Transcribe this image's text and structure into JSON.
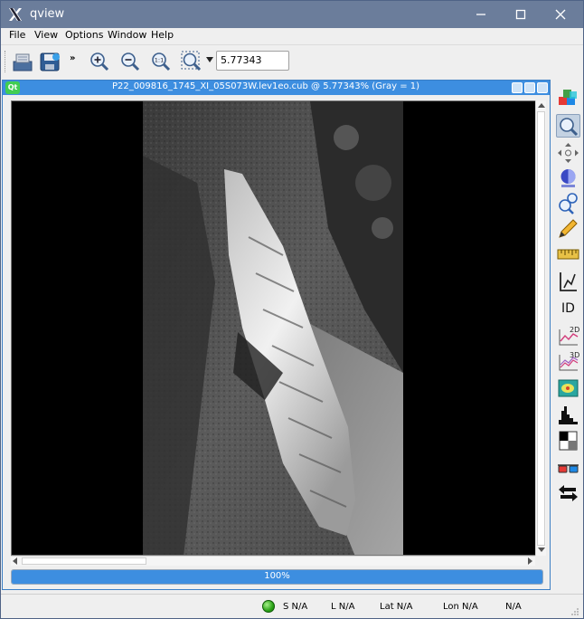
{
  "window": {
    "title": "qview"
  },
  "menu": [
    {
      "label": "File"
    },
    {
      "label": "View"
    },
    {
      "label": "Options"
    },
    {
      "label": "Window"
    },
    {
      "label": "Help"
    }
  ],
  "toolbar": {
    "more_glyph": "»",
    "zoom_value": "5.77343"
  },
  "subwindow": {
    "title": "P22_009816_1745_XI_05S073W.lev1eo.cub @ 5.77343% (Gray = 1)",
    "logo_text": "Qt"
  },
  "progress": {
    "percent": 100,
    "label": "100%"
  },
  "right_tools": [
    {
      "icon": "blend-cubes-icon"
    },
    {
      "icon": "zoom-tool-icon",
      "active": true
    },
    {
      "icon": "pan-tool-icon"
    },
    {
      "icon": "stretch-tool-icon"
    },
    {
      "icon": "find-tool-icon"
    },
    {
      "icon": "edit-tool-icon"
    },
    {
      "icon": "measure-tool-icon"
    },
    {
      "icon": "spectral-plot-icon"
    },
    {
      "icon": "id-tool-icon",
      "label": "ID"
    },
    {
      "icon": "plot-2d-icon",
      "label": "2D"
    },
    {
      "icon": "plot-3d-icon",
      "label": "3D"
    },
    {
      "icon": "map-stretch-icon"
    },
    {
      "icon": "histogram-icon"
    },
    {
      "icon": "contrast-icon"
    },
    {
      "icon": "stereo-glasses-icon"
    },
    {
      "icon": "link-arrows-icon"
    }
  ],
  "status": {
    "s": "S N/A",
    "l": "L N/A",
    "lat": "Lat N/A",
    "lon": "Lon N/A",
    "dn": "N/A"
  },
  "colors": {
    "title_bar": "#6b7d9b",
    "subwindow_title": "#3d8ee0",
    "progress_fill": "#3d8ee0",
    "status_led": "#2aa316"
  }
}
